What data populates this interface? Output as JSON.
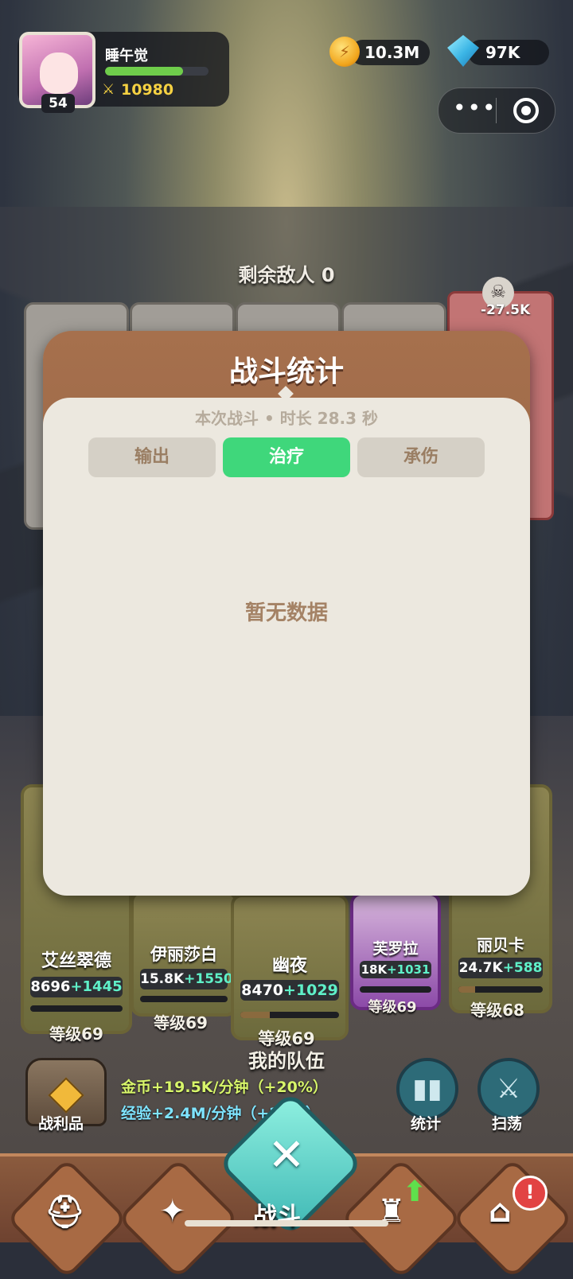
{
  "player": {
    "name": "睡午觉",
    "level": "54",
    "power": "10980",
    "exp_progress": 0.75
  },
  "resources": {
    "gold": "10.3M",
    "gems": "97K"
  },
  "battle": {
    "enemies_remaining": "剩余敌人 0",
    "damage_popup": "-27.5K"
  },
  "dialog": {
    "title": "战斗统计",
    "subtitle": "本次战斗 • 时长 28.3 秒",
    "tabs": [
      {
        "label": "输出",
        "active": false
      },
      {
        "label": "治疗",
        "active": true
      },
      {
        "label": "承伤",
        "active": false
      }
    ],
    "empty_text": "暂无数据"
  },
  "heroes": [
    {
      "name": "艾丝翠德",
      "power": "8696",
      "bonus": "+1445",
      "level": "等级69"
    },
    {
      "name": "伊丽莎白",
      "power": "15.8K",
      "bonus": "+1550",
      "level": "等级69"
    },
    {
      "name": "幽夜",
      "power": "8470",
      "bonus": "+1029",
      "level": "等级69"
    },
    {
      "name": "芙罗拉",
      "power": "18K",
      "bonus": "+1031",
      "level": "等级69"
    },
    {
      "name": "丽贝卡",
      "power": "24.7K",
      "bonus": "+588",
      "level": "等级68"
    }
  ],
  "team_label": "我的队伍",
  "loot": {
    "label": "战利品",
    "gold_rate": "金币+19.5K/分钟（+20%）",
    "exp_rate": "经验+2.4M/分钟（+20%）"
  },
  "actions": {
    "stats_label": "统计",
    "sweep_label": "扫荡"
  },
  "nav": {
    "battle_label": "战斗",
    "alert": "!"
  },
  "colors": {
    "active_tab": "#3fd77b",
    "dialog_header": "#a6704d",
    "dialog_body": "#ece8df"
  }
}
